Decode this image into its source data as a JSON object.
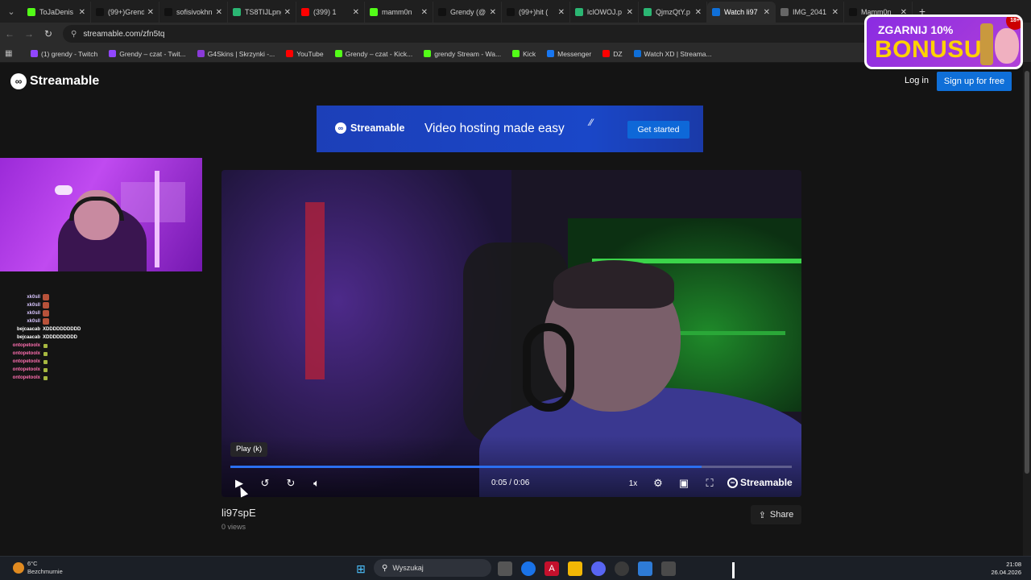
{
  "browser": {
    "tabs": [
      {
        "title": "ToJaDenis",
        "favicon": "kick-icon",
        "color": "#53fc18"
      },
      {
        "title": "(99+)Grendy",
        "favicon": "tiktok-icon",
        "color": "#111111"
      },
      {
        "title": "sofisivokhn",
        "favicon": "tiktok-icon",
        "color": "#111111"
      },
      {
        "title": "TS8TIJLpng",
        "favicon": "image-icon",
        "color": "#2bb673"
      },
      {
        "title": "(399) 1",
        "favicon": "youtube-icon",
        "color": "#ff0000"
      },
      {
        "title": "mamm0n",
        "favicon": "kick-icon",
        "color": "#53fc18"
      },
      {
        "title": "Grendy (@",
        "favicon": "tiktok-icon",
        "color": "#111111"
      },
      {
        "title": "(99+)hit (",
        "favicon": "tiktok-icon",
        "color": "#111111"
      },
      {
        "title": "lclOWOJ.p",
        "favicon": "image-icon",
        "color": "#2bb673"
      },
      {
        "title": "QjmzQtY.p",
        "favicon": "image-icon",
        "color": "#2bb673"
      },
      {
        "title": "Watch li97",
        "favicon": "streamable-icon",
        "color": "#0f6fd8"
      },
      {
        "title": "IMG_2041",
        "favicon": "globe-icon",
        "color": "#666666"
      },
      {
        "title": "Mamm0n",
        "favicon": "x-icon",
        "color": "#111111"
      }
    ],
    "active_tab_index": 10,
    "url": "streamable.com/zfn5tq",
    "bookmarks": [
      {
        "label": "(1) grendy - Twitch",
        "icon": "twitch-icon",
        "color": "#9146ff"
      },
      {
        "label": "Grendy – czat - Twit...",
        "icon": "twitch-icon",
        "color": "#9146ff"
      },
      {
        "label": "G4Skins | Skrzynki -...",
        "icon": "g4skins-icon",
        "color": "#8a3ad8"
      },
      {
        "label": "YouTube",
        "icon": "youtube-icon",
        "color": "#ff0000"
      },
      {
        "label": "Grendy – czat - Kick...",
        "icon": "kick-icon",
        "color": "#53fc18"
      },
      {
        "label": "grendy Stream - Wa...",
        "icon": "kick-icon",
        "color": "#53fc18"
      },
      {
        "label": "Kick",
        "icon": "kick-icon",
        "color": "#53fc18"
      },
      {
        "label": "Messenger",
        "icon": "facebook-icon",
        "color": "#1877f2"
      },
      {
        "label": "DZ",
        "icon": "youtube-icon",
        "color": "#ff0000"
      },
      {
        "label": "Watch XD | Streama...",
        "icon": "streamable-icon",
        "color": "#0f6fd8"
      }
    ]
  },
  "promo": {
    "line1": "ZGARNIJ 10%",
    "line2": "BONUSU",
    "age": "18+"
  },
  "site": {
    "logo": "Streamable",
    "login": "Log in",
    "signup": "Sign up for free"
  },
  "banner": {
    "logo": "Streamable",
    "tagline": "Video hosting made easy",
    "cta": "Get started"
  },
  "chat": [
    {
      "user": "xk0sll",
      "color": "#d9c6ff",
      "text": "",
      "emote": "emote-icon"
    },
    {
      "user": "xk0sll",
      "color": "#d9c6ff",
      "text": "",
      "emote": "emote-icon"
    },
    {
      "user": "xk0sll",
      "color": "#d9c6ff",
      "text": "",
      "emote": "emote-icon"
    },
    {
      "user": "xk0sll",
      "color": "#d9c6ff",
      "text": "",
      "emote": "emote-icon"
    },
    {
      "user": "bejcaacab",
      "color": "#ffffff",
      "text": "XDDDDDDDDDD",
      "emote": ""
    },
    {
      "user": "bejcaacab",
      "color": "#ffffff",
      "text": "XDDDDDDDDD",
      "emote": ""
    },
    {
      "user": "ontopetoolx",
      "color": "#ff6fb0",
      "text": "",
      "emote": "small-emote-icon"
    },
    {
      "user": "ontopetoolx",
      "color": "#ff6fb0",
      "text": "",
      "emote": "small-emote-icon"
    },
    {
      "user": "ontopetoolx",
      "color": "#ff6fb0",
      "text": "",
      "emote": "small-emote-icon"
    },
    {
      "user": "ontopetoolx",
      "color": "#ff6fb0",
      "text": "",
      "emote": "small-emote-icon"
    },
    {
      "user": "ontopetoolx",
      "color": "#ff6fb0",
      "text": "",
      "emote": "small-emote-icon"
    }
  ],
  "player": {
    "tooltip": "Play (k)",
    "time": "0:05 / 0:06",
    "progress": 0.84,
    "speed": "1x",
    "brand": "Streamable",
    "accent": "#2b6ff0"
  },
  "video": {
    "title": "li97spE",
    "views": "0 views",
    "share": "Share"
  },
  "taskbar": {
    "temp": "6°C",
    "weather": "Bezchmurnie",
    "search": "Wyszukaj",
    "time": "21:08",
    "date": "26.04.2026"
  }
}
